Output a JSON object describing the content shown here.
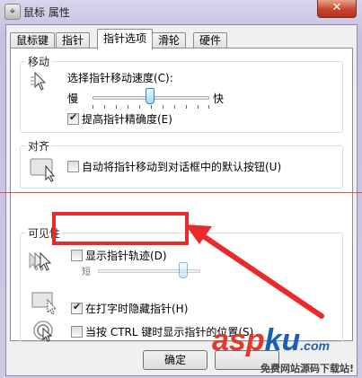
{
  "window": {
    "title": "鼠标 属性",
    "close_glyph": "✕"
  },
  "tabs": [
    {
      "label": "鼠标键"
    },
    {
      "label": "指针"
    },
    {
      "label": "指针选项",
      "active": true
    },
    {
      "label": "滑轮"
    },
    {
      "label": "硬件"
    }
  ],
  "motion": {
    "title": "移动",
    "speed_label": "选择指针移动速度(C):",
    "slow_label": "慢",
    "fast_label": "快",
    "speed_fraction": 0.5,
    "precision_label": "提高指针精确度(E)",
    "precision_checked": true
  },
  "snap": {
    "title": "对齐",
    "snap_label": "自动将指针移动到对话框中的默认按钮(U)",
    "snap_checked": false
  },
  "visibility": {
    "title": "可见性",
    "trails_label": "显示指针轨迹(D)",
    "trails_checked": false,
    "short_label": "短",
    "trail_fraction": 0.85,
    "hide_label": "在打字时隐藏指针(H)",
    "hide_checked": true,
    "ctrl_label": "当按 CTRL 键时显示指针的位置(S)",
    "ctrl_checked": false
  },
  "buttons": {
    "ok": "确定"
  },
  "watermark": {
    "brand_a": "asp",
    "brand_b": "ku",
    "brand_c": ".com",
    "tagline": "免费网站源码下载站!"
  },
  "colors": {
    "highlight_red": "#ea2a2a",
    "watermark_red": "#e03a2a",
    "watermark_blue": "#1a5fb4"
  }
}
